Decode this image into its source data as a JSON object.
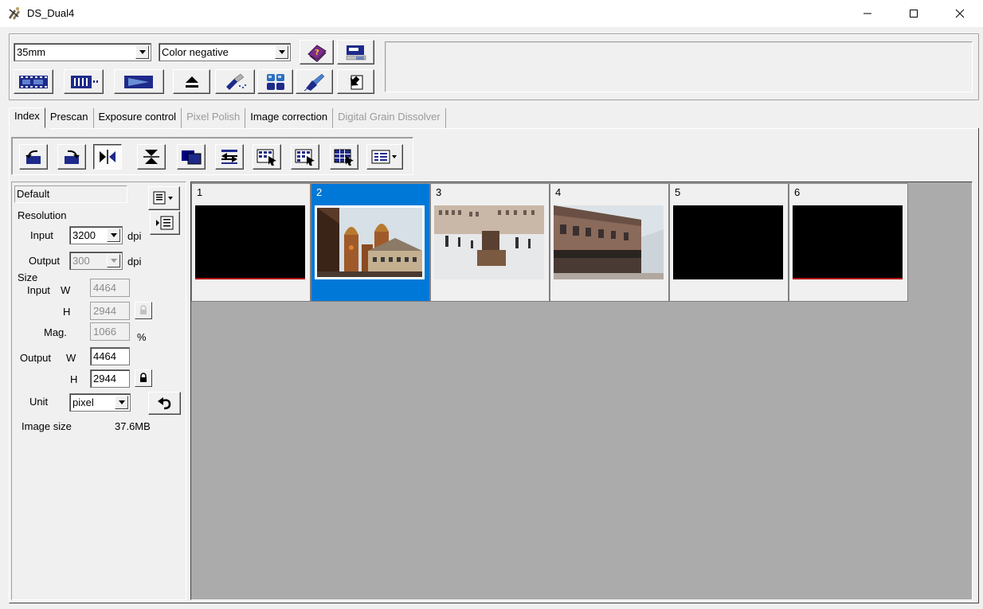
{
  "window": {
    "title": "DS_Dual4"
  },
  "toolbar": {
    "film_type": "35mm",
    "film_mode": "Color negative"
  },
  "tabs": [
    {
      "label": "Index",
      "active": true,
      "enabled": true
    },
    {
      "label": "Prescan",
      "active": false,
      "enabled": true
    },
    {
      "label": "Exposure control",
      "active": false,
      "enabled": true
    },
    {
      "label": "Pixel Polish",
      "active": false,
      "enabled": false
    },
    {
      "label": "Image correction",
      "active": false,
      "enabled": true
    },
    {
      "label": "Digital Grain Dissolver",
      "active": false,
      "enabled": false
    }
  ],
  "settings": {
    "preset": "Default",
    "resolution_label": "Resolution",
    "input_label": "Input",
    "input_dpi": "3200",
    "output_label": "Output",
    "output_dpi": "300",
    "dpi_unit": "dpi",
    "size_label": "Size",
    "size_input_label": "Input",
    "w_label": "W",
    "h_label": "H",
    "input_w": "4464",
    "input_h": "2944",
    "mag_label": "Mag.",
    "mag": "1066",
    "mag_unit": "%",
    "output_size_label": "Output",
    "output_w": "4464",
    "output_h": "2944",
    "unit_label": "Unit",
    "unit": "pixel",
    "image_size_label": "Image size",
    "image_size": "37.6MB"
  },
  "frames": [
    {
      "number": "1",
      "selected": false,
      "content": "black"
    },
    {
      "number": "2",
      "selected": true,
      "content": "towers"
    },
    {
      "number": "3",
      "selected": false,
      "content": "square"
    },
    {
      "number": "4",
      "selected": false,
      "content": "street"
    },
    {
      "number": "5",
      "selected": false,
      "content": "black"
    },
    {
      "number": "6",
      "selected": false,
      "content": "black"
    }
  ],
  "colors": {
    "selection": "#0078d7",
    "film_bg": "#ababab",
    "frame_bg": "#f0f0f0"
  }
}
